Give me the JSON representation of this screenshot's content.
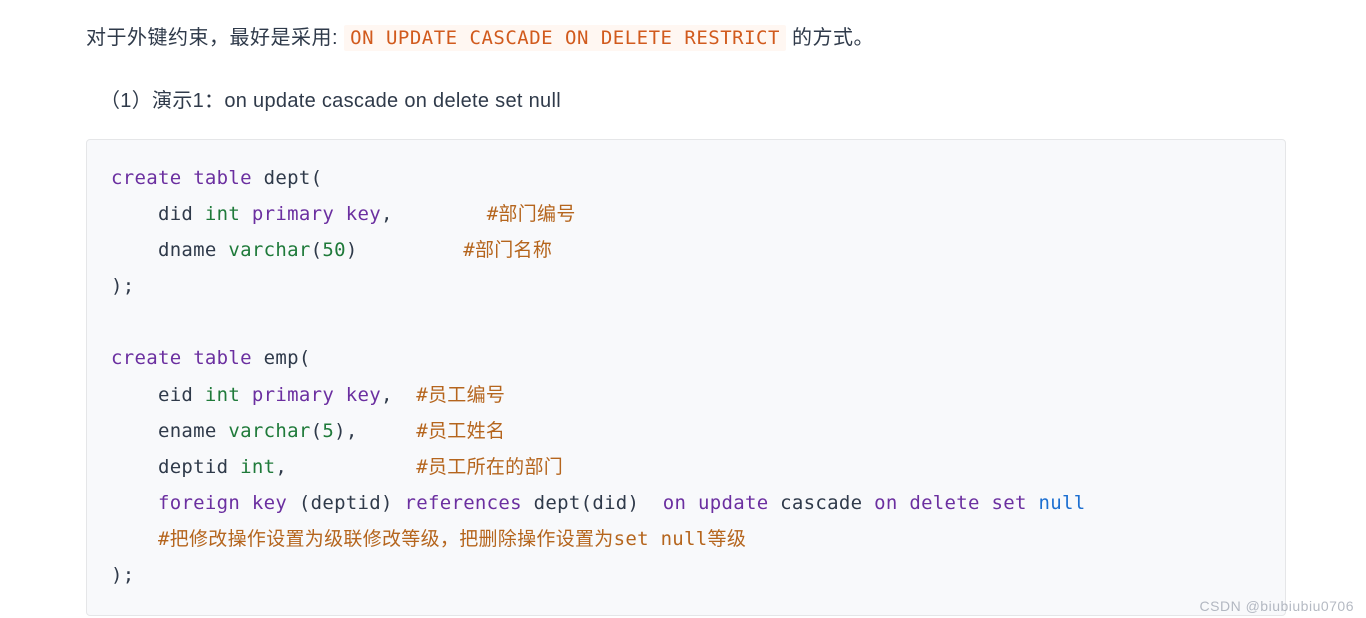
{
  "intro": {
    "pre": "对于外键约束，最好是采用: ",
    "code": "ON UPDATE CASCADE ON DELETE RESTRICT",
    "post": " 的方式。"
  },
  "demo_title": "（1）演示1：on update cascade on delete set null",
  "code": {
    "l1_kw1": "create",
    "l1_kw2": "table",
    "l1_id": " dept(",
    "l2_pre": "    did ",
    "l2_type": "int",
    "l2_mid": " ",
    "l2_kw": "primary key",
    "l2_post": ",        ",
    "l2_cm": "#部门编号",
    "l3_pre": "    dname ",
    "l3_type": "varchar",
    "l3_post1": "(",
    "l3_num": "50",
    "l3_post2": ")         ",
    "l3_cm": "#部门名称",
    "l4": ");",
    "blank": "",
    "l5_kw1": "create",
    "l5_kw2": "table",
    "l5_id": " emp(",
    "l6_pre": "    eid ",
    "l6_type": "int",
    "l6_mid": " ",
    "l6_kw": "primary key",
    "l6_post": ",  ",
    "l6_cm": "#员工编号",
    "l7_pre": "    ename ",
    "l7_type": "varchar",
    "l7_post1": "(",
    "l7_num": "5",
    "l7_post2": "),     ",
    "l7_cm": "#员工姓名",
    "l8_pre": "    deptid ",
    "l8_type": "int",
    "l8_post": ",           ",
    "l8_cm": "#员工所在的部门",
    "l9_pre": "    ",
    "l9_kw1": "foreign key",
    "l9_mid1": " (deptid) ",
    "l9_kw2": "references",
    "l9_mid2": " dept(did)  ",
    "l9_kw3": "on",
    "l9_mid3": " ",
    "l9_kw4": "update",
    "l9_mid4": " cascade ",
    "l9_kw5": "on",
    "l9_mid5": " ",
    "l9_kw6": "delete",
    "l9_mid6": " ",
    "l9_kw7": "set",
    "l9_mid7": " ",
    "l9_lit": "null",
    "l10_pre": "    ",
    "l10_cm": "#把修改操作设置为级联修改等级，把删除操作设置为set null等级",
    "l11": ");"
  },
  "watermark": "CSDN @biubiubiu0706"
}
